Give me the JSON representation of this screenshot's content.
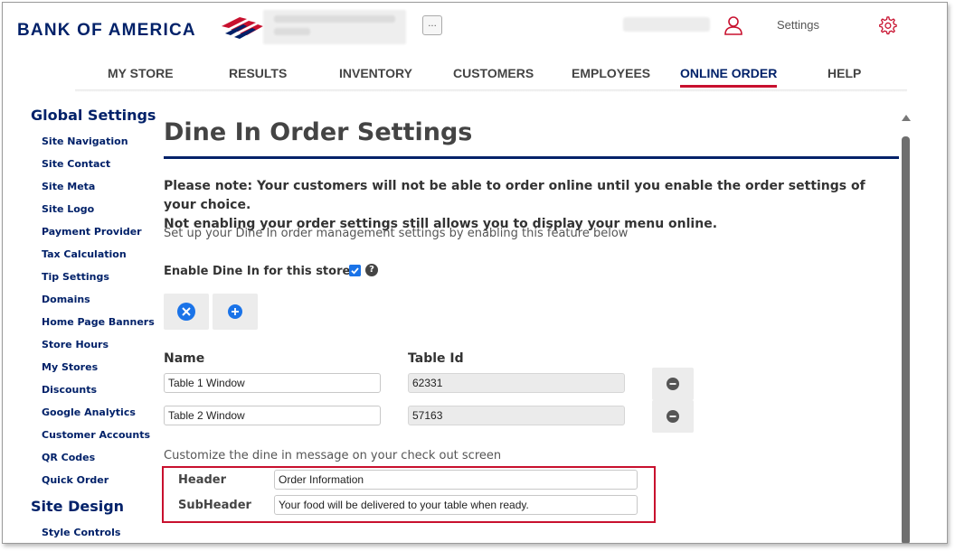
{
  "brand": {
    "name": "BANK OF AMERICA",
    "colors": {
      "navy": "#012169",
      "red": "#c8102e"
    }
  },
  "header": {
    "more_label": "...",
    "settings_label": "Settings"
  },
  "nav": {
    "items": [
      "MY STORE",
      "RESULTS",
      "INVENTORY",
      "CUSTOMERS",
      "EMPLOYEES",
      "ONLINE ORDER",
      "HELP"
    ],
    "active": "ONLINE ORDER"
  },
  "sidebar": {
    "global_heading": "Global Settings",
    "global_items": [
      "Site Navigation",
      "Site Contact",
      "Site Meta",
      "Site Logo",
      "Payment Provider",
      "Tax Calculation",
      "Tip Settings",
      "Domains",
      "Home Page Banners",
      "Store Hours",
      "My Stores",
      "Discounts",
      "Google Analytics",
      "Customer Accounts",
      "QR Codes",
      "Quick Order"
    ],
    "design_heading": "Site Design",
    "design_items": [
      "Style Controls"
    ]
  },
  "main": {
    "title": "Dine In Order Settings",
    "note_line1": "Please note: Your customers will not be able to order online until you enable the order settings of your choice.",
    "note_line2": "Not enabling your order settings still allows you to display your menu online.",
    "intro": "Set up your Dine In order management settings by enabling this feature below",
    "enable_label": "Enable Dine In for this store?",
    "enable_checked": true,
    "help_glyph": "?",
    "table": {
      "col_name": "Name",
      "col_table_id": "Table Id",
      "rows": [
        {
          "name": "Table 1 Window",
          "table_id": "62331"
        },
        {
          "name": "Table 2 Window",
          "table_id": "57163"
        }
      ]
    },
    "customize_label": "Customize the dine in message on your check out screen",
    "header_label": "Header",
    "header_value": "Order Information",
    "subheader_label": "SubHeader",
    "subheader_value": "Your food will be delivered to your table when ready."
  }
}
